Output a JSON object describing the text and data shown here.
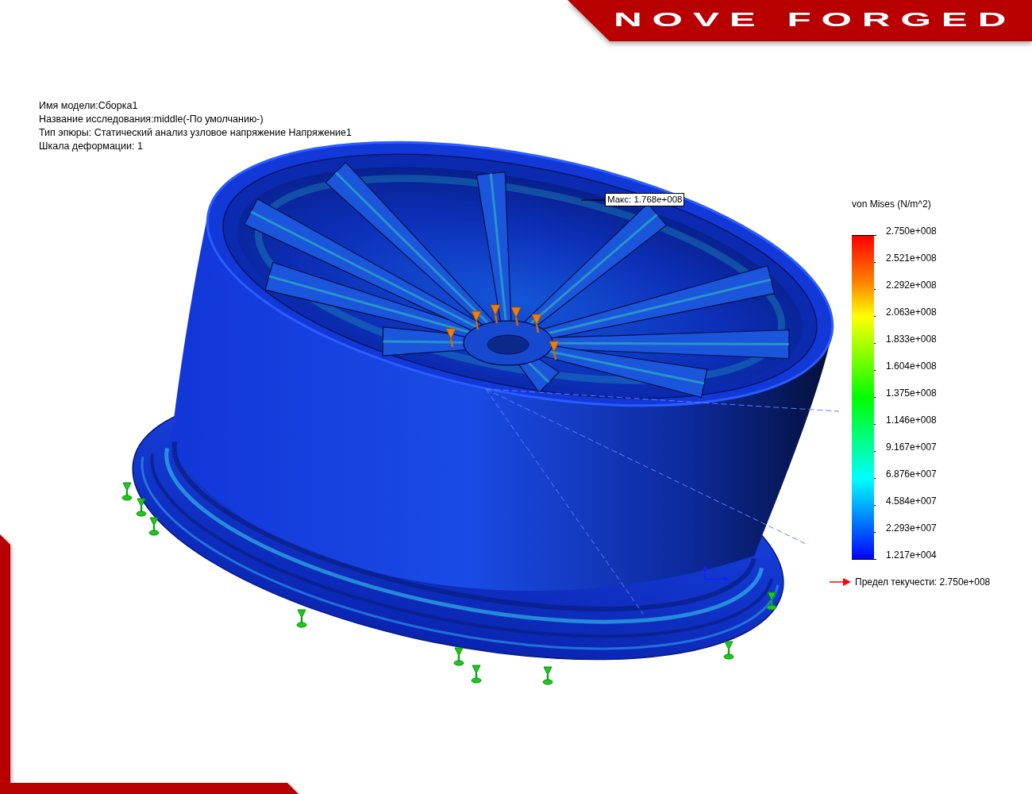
{
  "brand": {
    "logo": "NOVE FORGED"
  },
  "plot_info": [
    "Имя модели:Сборка1",
    "Название исследования:middle(-По умолчанию-)",
    "Тип эпюры: Статический анализ узловое напряжение Напряжение1",
    "Шкала деформации: 1"
  ],
  "max_label": "Макс: 1.768e+008",
  "legend": {
    "title": "von Mises (N/m^2)",
    "ticks": [
      "2.750e+008",
      "2.521e+008",
      "2.292e+008",
      "2.063e+008",
      "1.833e+008",
      "1.604e+008",
      "1.375e+008",
      "1.146e+008",
      "9.167e+007",
      "6.876e+007",
      "4.584e+007",
      "2.293e+007",
      "1.217e+004"
    ],
    "yield_strength": "Предел текучести: 2.750e+008"
  }
}
